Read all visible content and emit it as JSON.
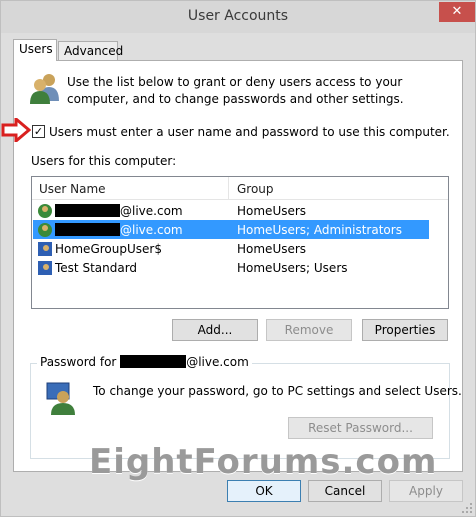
{
  "window": {
    "title": "User Accounts",
    "close_label": "✕"
  },
  "tabs": [
    {
      "label": "Users"
    },
    {
      "label": "Advanced"
    }
  ],
  "intro": "Use the list below to grant or deny users access to your computer, and to change passwords and other settings.",
  "require_login": {
    "label": "Users must enter a user name and password to use this computer.",
    "checked": true,
    "mark": "✓"
  },
  "users_section_label": "Users for this computer:",
  "list": {
    "columns": [
      "User Name",
      "Group"
    ],
    "rows": [
      {
        "name": "@live.com",
        "group": "HomeUsers",
        "redacted": true,
        "selected": false
      },
      {
        "name": "@live.com",
        "group": "HomeUsers; Administrators",
        "redacted": true,
        "selected": true
      },
      {
        "name": "HomeGroupUser$",
        "group": "HomeUsers",
        "redacted": false,
        "selected": false
      },
      {
        "name": "Test Standard",
        "group": "HomeUsers; Users",
        "redacted": false,
        "selected": false
      }
    ]
  },
  "buttons": {
    "add": "Add...",
    "remove": "Remove",
    "properties": "Properties",
    "reset_password": "Reset Password...",
    "ok": "OK",
    "cancel": "Cancel",
    "apply": "Apply"
  },
  "password_group": {
    "legend_prefix": "Password for",
    "legend_suffix": "@live.com",
    "text": "To change your password, go to PC settings and select Users."
  },
  "watermark": "EightForums.com",
  "colors": {
    "selection": "#3399ff",
    "arrow": "#d9201f",
    "accent": "#3c7fb1"
  }
}
